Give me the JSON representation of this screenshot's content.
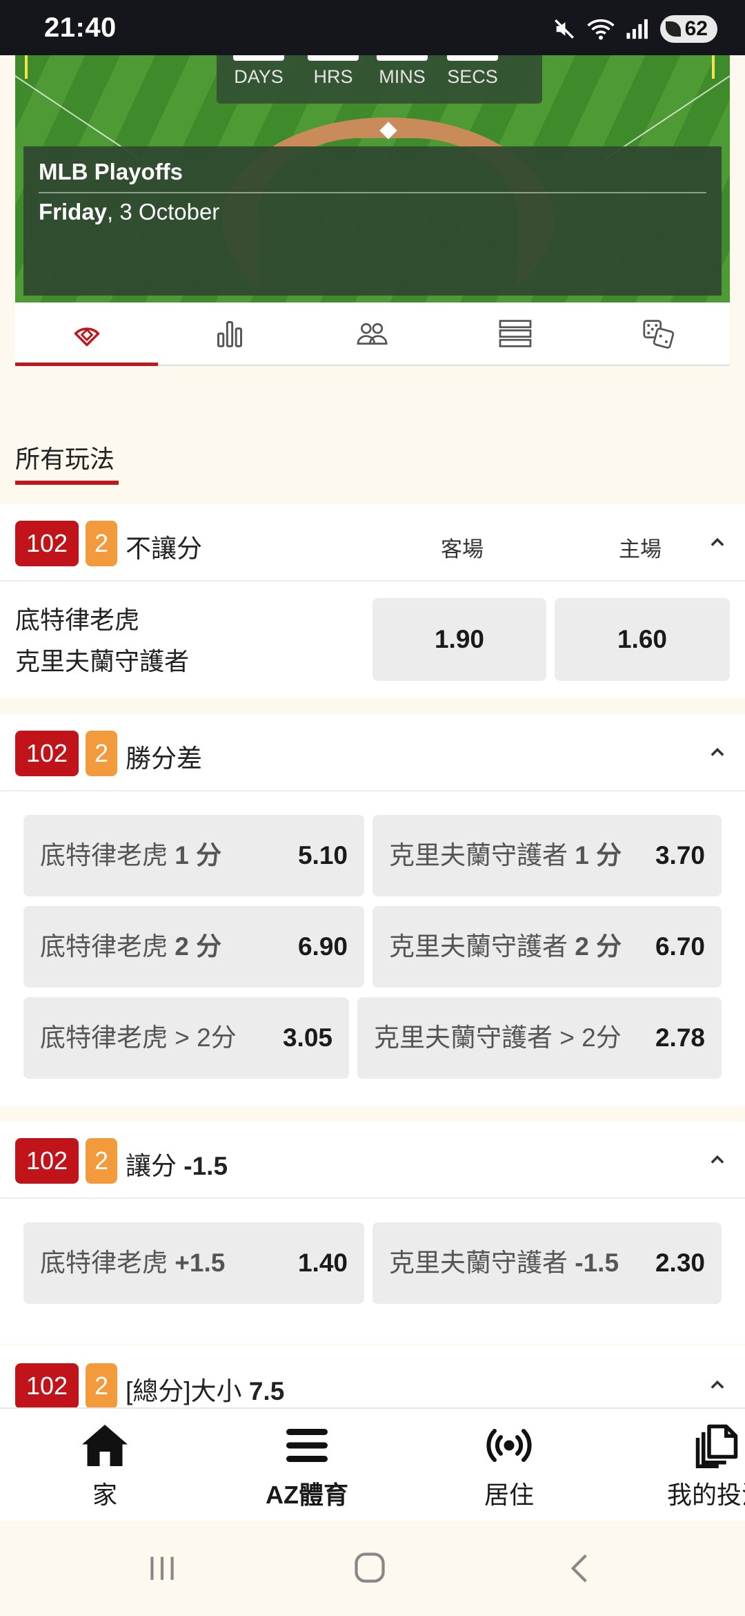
{
  "status_bar": {
    "time": "21:40",
    "battery": "62"
  },
  "hero": {
    "countdown_labels": [
      "DAYS",
      "HRS",
      "MINS",
      "SECS"
    ],
    "event_title": "MLB Playoffs",
    "event_day": "Friday",
    "event_date": ", 3 October"
  },
  "tabs": [
    {
      "icon": "baseball-field-icon",
      "active": true
    },
    {
      "icon": "bar-chart-icon",
      "active": false
    },
    {
      "icon": "players-icon",
      "active": false
    },
    {
      "icon": "list-icon",
      "active": false
    },
    {
      "icon": "dice-icon",
      "active": false
    }
  ],
  "section": {
    "title": "所有玩法"
  },
  "markets": [
    {
      "id": "102",
      "period": "2",
      "title": "不讓分",
      "col_away": "客場",
      "col_home": "主場",
      "team_away": "底特律老虎",
      "team_home": "克里夫蘭守護者",
      "odds_away": "1.90",
      "odds_home": "1.60"
    },
    {
      "id": "102",
      "period": "2",
      "title": "勝分差",
      "picks": [
        {
          "team": "底特律老虎",
          "margin": "1 分",
          "odds": "5.10"
        },
        {
          "team": "克里夫蘭守護者",
          "margin": "1 分",
          "odds": "3.70"
        },
        {
          "team": "底特律老虎",
          "margin": "2 分",
          "odds": "6.90"
        },
        {
          "team": "克里夫蘭守護者",
          "margin": "2 分",
          "odds": "6.70"
        },
        {
          "team": "底特律老虎",
          "margin": "> 2分",
          "odds": "3.05"
        },
        {
          "team": "克里夫蘭守護者",
          "margin": "> 2分",
          "odds": "2.78"
        }
      ]
    },
    {
      "id": "102",
      "period": "2",
      "title_prefix": "讓分 ",
      "title_value": "-1.5",
      "picks": [
        {
          "team": "底特律老虎",
          "line": "+1.5",
          "odds": "1.40"
        },
        {
          "team": "克里夫蘭守護者",
          "line": "-1.5",
          "odds": "2.30"
        }
      ]
    },
    {
      "id": "102",
      "period": "2",
      "title_prefix": "[總分]大小 ",
      "title_value": "7.5"
    }
  ],
  "bottom_nav": [
    {
      "icon": "home-icon",
      "label": "家"
    },
    {
      "icon": "menu-icon",
      "label": "AZ體育"
    },
    {
      "icon": "live-broadcast-icon",
      "label": "居住"
    },
    {
      "icon": "copy-docs-icon",
      "label": "我的投注"
    }
  ]
}
